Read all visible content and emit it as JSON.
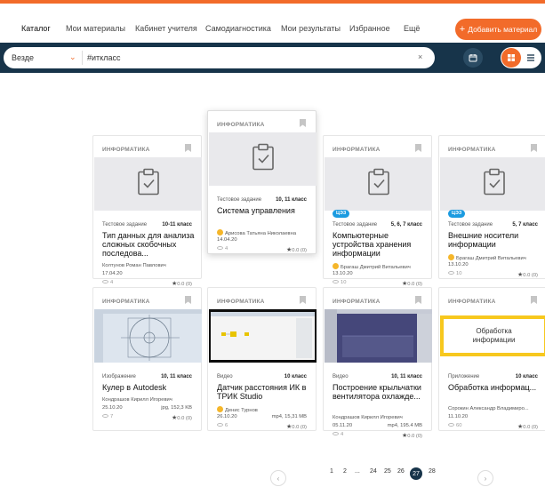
{
  "nav": {
    "items": [
      "Каталог",
      "Мои материалы",
      "Кабинет учителя",
      "Самодиагностика",
      "Мои результаты",
      "Избранное",
      "Ещё"
    ],
    "add_button": "Добавить материал"
  },
  "search": {
    "scope": "Везде",
    "query": "#иткласс",
    "clear": "×"
  },
  "cards": [
    {
      "subject": "ИНФОРМАТИКА",
      "badge": "",
      "type": "Тестовое задание",
      "grade": "10-11 класс",
      "title": "Тип данных для анализа сложных скобочных последова...",
      "author": "Колтунов Роман Павлович",
      "date": "17.04.20",
      "file": "",
      "views": "4",
      "rating": "0.0 (0)",
      "thumb": "icon"
    },
    {
      "subject": "ИНФОРМАТИКА",
      "badge": "",
      "type": "Тестовое задание",
      "grade": "10, 11 класс",
      "title": "Система управления",
      "author": "Арисова Татьяна Николаевна",
      "date": "14.04.20",
      "file": "",
      "views": "4",
      "rating": "0.0 (0)",
      "thumb": "icon"
    },
    {
      "subject": "ИНФОРМАТИКА",
      "badge": "ЦЭЗ",
      "type": "Тестовое задание",
      "grade": "5, 6, 7 класс",
      "title": "Компьютерные устройства хранения информации",
      "author": "Брагаш Дмитрий Витальевич",
      "date": "13.10.20",
      "file": "",
      "views": "10",
      "rating": "0.0 (0)",
      "thumb": "icon"
    },
    {
      "subject": "ИНФОРМАТИКА",
      "badge": "ЦЭЗ",
      "type": "Тестовое задание",
      "grade": "5, 7 класс",
      "title": "Внешние носители информации",
      "author": "Брагаш Дмитрий Витальевич",
      "date": "13.10.20",
      "file": "",
      "views": "10",
      "rating": "0.0 (0)",
      "thumb": "icon"
    },
    {
      "subject": "ИНФОРМАТИКА",
      "badge": "",
      "type": "Изображение",
      "grade": "10, 11 класс",
      "title": "Кулер в Autodesk",
      "author": "Кондрашов Кирилл Игоревич",
      "date": "25.10.20",
      "file": "jpg, 152,3 KB",
      "views": "7",
      "rating": "0.0 (0)",
      "thumb": "cad"
    },
    {
      "subject": "ИНФОРМАТИКА",
      "badge": "",
      "type": "Видео",
      "grade": "10 класс",
      "title": "Датчик расстояния ИК в ТРИК Studio",
      "author": "Денис Турнов",
      "date": "26.10.20",
      "file": "mp4, 15,31 MB",
      "views": "6",
      "rating": "0.0 (0)",
      "thumb": "trik"
    },
    {
      "subject": "ИНФОРМАТИКА",
      "badge": "",
      "type": "Видео",
      "grade": "10, 11 класс",
      "title": "Построение крыльчатки вентилятора охлажде...",
      "author": "Кондрашов Кирилл Игоревич",
      "date": "05.11.20",
      "file": "mp4, 195.4 MB",
      "views": "4",
      "rating": "0.0 (0)",
      "thumb": "fan"
    },
    {
      "subject": "ИНФОРМАТИКА",
      "badge": "",
      "type": "Приложение",
      "grade": "10 класс",
      "title": "Обработка информац...",
      "author": "Сорокин Александр Владимиро...",
      "date": "11.10.20",
      "file": "",
      "views": "60",
      "rating": "0.0 (0)",
      "thumb": "obr",
      "thumb_text": "Обработка информации"
    }
  ],
  "pagination": {
    "prev": "‹",
    "next": "›",
    "pages": [
      "1",
      "2",
      "...",
      "24",
      "25",
      "26"
    ],
    "current": "27",
    "last": "28"
  },
  "colors": {
    "accent": "#f26b2a",
    "bar": "#17344a",
    "ceo": "#1b9be0"
  }
}
